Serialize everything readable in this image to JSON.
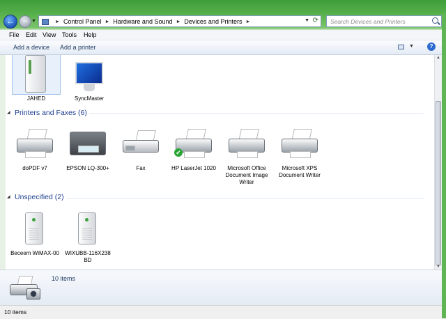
{
  "address": {
    "crumbs": [
      "Control Panel",
      "Hardware and Sound",
      "Devices and Printers"
    ]
  },
  "search": {
    "placeholder": "Search Devices and Printers"
  },
  "menu": [
    "File",
    "Edit",
    "View",
    "Tools",
    "Help"
  ],
  "commands": {
    "add_device": "Add a device",
    "add_printer": "Add a printer"
  },
  "devices_top": [
    {
      "label": "JAHED",
      "icon": "tower-computer-icon"
    },
    {
      "label": "SyncMaster",
      "icon": "monitor-icon"
    }
  ],
  "printers_group": {
    "title": "Printers and Faxes (6)",
    "items": [
      {
        "label": "doPDF v7",
        "icon": "printer-icon"
      },
      {
        "label": "EPSON LQ-300+",
        "icon": "dot-matrix-printer-icon"
      },
      {
        "label": "Fax",
        "icon": "fax-icon"
      },
      {
        "label": "HP LaserJet 1020",
        "icon": "printer-icon",
        "default": true
      },
      {
        "label": "Microsoft Office Document Image Writer",
        "icon": "printer-icon"
      },
      {
        "label": "Microsoft XPS Document Writer",
        "icon": "printer-icon"
      }
    ]
  },
  "unspecified_group": {
    "title": "Unspecified (2)",
    "items": [
      {
        "label": "Beceem WiMAX-00",
        "icon": "tower-device-icon"
      },
      {
        "label": "WIXUBB-116X238 BD",
        "icon": "tower-device-icon"
      }
    ]
  },
  "details": {
    "count": "10 items"
  },
  "status": {
    "text": "10 items"
  }
}
